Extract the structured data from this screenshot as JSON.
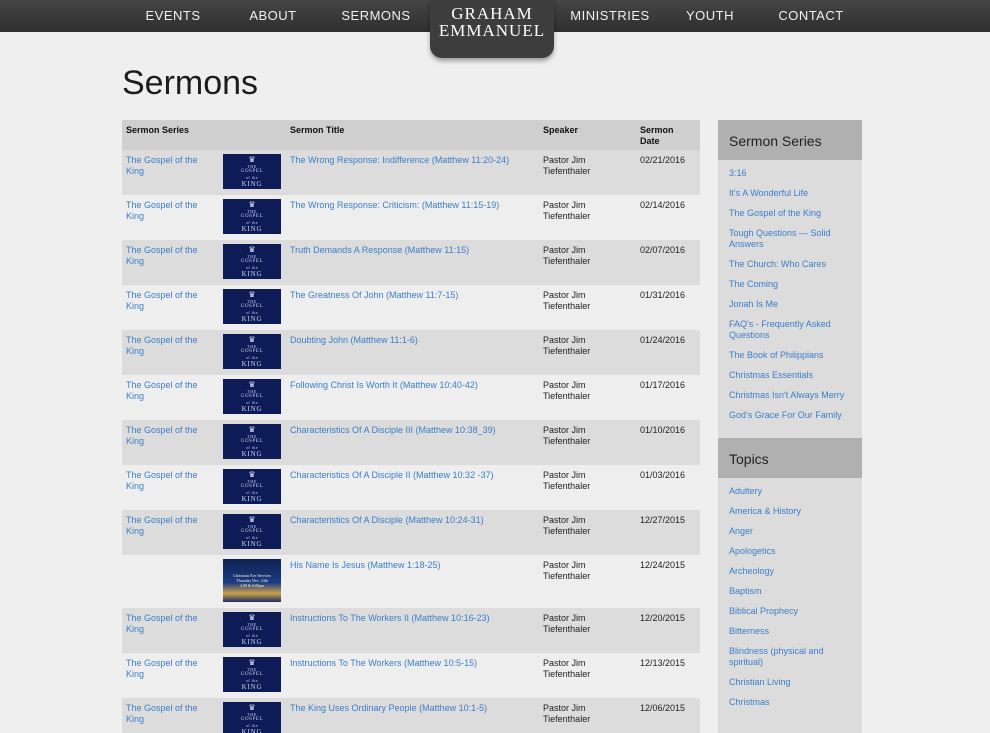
{
  "nav": {
    "items": [
      "EVENTS",
      "ABOUT",
      "SERMONS",
      "MINISTRIES",
      "YOUTH",
      "CONTACT"
    ],
    "logo_line1": "GRAHAM",
    "logo_line2": "EMMANUEL"
  },
  "page": {
    "title": "Sermons"
  },
  "table": {
    "headers": {
      "series": "Sermon Series",
      "title": "Sermon Title",
      "speaker": "Speaker",
      "date": "Sermon Date"
    },
    "thumb": {
      "line1": "THE",
      "line2": "GOSPEL",
      "line3": "KING",
      "of": "of the"
    },
    "xmas_thumb": {
      "line1": "Christmas Eve Services",
      "line2": "Thursday Dec. 24th",
      "line3": "4:00 & 6:00pm"
    },
    "rows": [
      {
        "series": "The Gospel of the King",
        "title": "The Wrong Response: Indifference (Matthew 11:20-24)",
        "speaker": "Pastor Jim Tiefenthaler",
        "date": "02/21/2016"
      },
      {
        "series": "The Gospel of the King",
        "title": "The Wrong Response: Criticism: (Matthew 11:15-19)",
        "speaker": "Pastor Jim Tiefenthaler",
        "date": "02/14/2016"
      },
      {
        "series": "The Gospel of the King",
        "title": "Truth Demands A Response (Matthew 11:15)",
        "speaker": "Pastor Jim Tiefenthaler",
        "date": "02/07/2016"
      },
      {
        "series": "The Gospel of the King",
        "title": "The Greatness Of John (Matthew 11:7-15)",
        "speaker": "Pastor Jim Tiefenthaler",
        "date": "01/31/2016"
      },
      {
        "series": "The Gospel of the King",
        "title": "Doubting John (Matthew 11:1-6)",
        "speaker": "Pastor Jim Tiefenthaler",
        "date": "01/24/2016"
      },
      {
        "series": "The Gospel of the King",
        "title": "Following Christ Is Worth It (Matthew 10:40-42)",
        "speaker": "Pastor Jim Tiefenthaler",
        "date": "01/17/2016"
      },
      {
        "series": "The Gospel of the King",
        "title": "Characteristics Of A Disciple III (Matthew 10:38_39)",
        "speaker": "Pastor Jim Tiefenthaler",
        "date": "01/10/2016"
      },
      {
        "series": "The Gospel of the King",
        "title": "Characteristics Of A Disciple II (Matthew 10:32 -37)",
        "speaker": "Pastor Jim Tiefenthaler",
        "date": "01/03/2016"
      },
      {
        "series": "The Gospel of the King",
        "title": "Characteristics Of A Disciple (Matthew 10:24-31)",
        "speaker": "Pastor Jim Tiefenthaler",
        "date": "12/27/2015"
      },
      {
        "series": "",
        "title": "His Name Is Jesus (Matthew 1:18-25)",
        "speaker": "Pastor Jim Tiefenthaler",
        "date": "12/24/2015"
      },
      {
        "series": "The Gospel of the King",
        "title": "Instructions To The Workers II (Matthew 10:16-23)",
        "speaker": "Pastor Jim Tiefenthaler",
        "date": "12/20/2015"
      },
      {
        "series": "The Gospel of the King",
        "title": "Instructions To The Workers (Matthew 10:5-15)",
        "speaker": "Pastor Jim Tiefenthaler",
        "date": "12/13/2015"
      },
      {
        "series": "The Gospel of the King",
        "title": "The King Uses Ordinary People (Matthew 10:1-5)",
        "speaker": "Pastor Jim Tiefenthaler",
        "date": "12/06/2015"
      }
    ]
  },
  "sidebar": {
    "series_heading": "Sermon Series",
    "series": [
      "3:16",
      "It's A Wonderful Life",
      "The Gospel of the King",
      "Tough Questions — Solid Answers",
      "The Church: Who Cares",
      "The Coming",
      "Jonah Is Me",
      "FAQ's - Frequently Asked Questions",
      "The Book of Philippians",
      "Christmas Essentials",
      "Christmas Isn't Always Merry",
      "God's Grace For Our Family"
    ],
    "topics_heading": "Topics",
    "topics": [
      "Adultery",
      "America & History",
      "Anger",
      "Apologetics",
      "Archeology",
      "Baptism",
      "Biblical Prophecy",
      "Bitterness",
      "Blindness (physical and spiritual)",
      "Christian Living",
      "Christmas"
    ]
  },
  "colors": {
    "link": "#3b7ec9",
    "nav_bg": "#3a3a3a",
    "thumb_bg": "#0d1b57"
  }
}
